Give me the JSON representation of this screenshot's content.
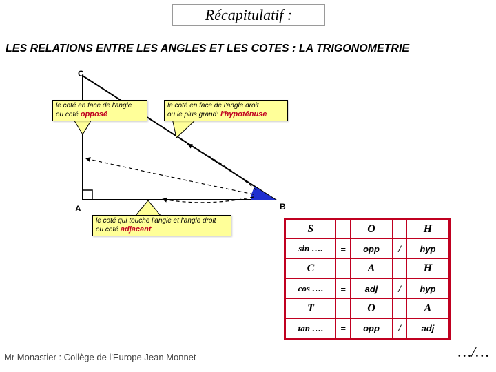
{
  "title": "Récapitulatif :",
  "subtitle": "LES RELATIONS ENTRE LES ANGLES ET LES COTES : LA TRIGONOMETRIE",
  "vertices": {
    "A": "A",
    "B": "B",
    "C": "C"
  },
  "callouts": {
    "opp": {
      "line1": "le coté en face de l'angle",
      "line2_prefix": "ou coté",
      "keyword": " opposé"
    },
    "hyp": {
      "line1": "le coté en face de l'angle droit",
      "line2_prefix": "ou le plus grand:",
      "keyword": " l'hypoténuse"
    },
    "adj": {
      "line1": "le coté qui touche l'angle et l'angle droit",
      "line2_prefix": "ou coté",
      "keyword": " adjacent"
    }
  },
  "table": {
    "row1": [
      "S",
      "",
      "O",
      "",
      "H"
    ],
    "row2": [
      "sin ….",
      "=",
      "opp",
      "/",
      "hyp"
    ],
    "row3": [
      "C",
      "",
      "A",
      "",
      "H"
    ],
    "row4": [
      "cos ….",
      "=",
      "adj",
      "/",
      "hyp"
    ],
    "row5": [
      "T",
      "",
      "O",
      "",
      "A"
    ],
    "row6": [
      "tan ….",
      "=",
      "opp",
      "/",
      "adj"
    ]
  },
  "footer": {
    "left": "Mr Monastier : Collège de l'Europe Jean Monnet",
    "right": "…/…"
  }
}
